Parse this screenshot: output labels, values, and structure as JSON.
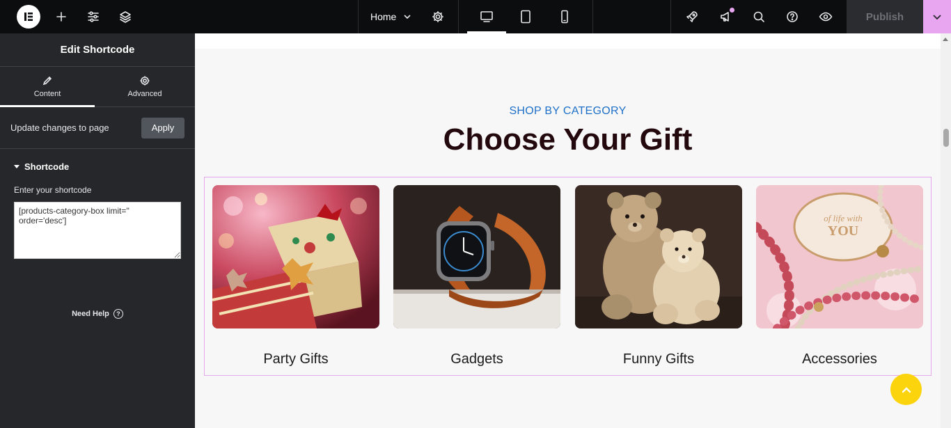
{
  "topbar": {
    "home_label": "Home",
    "publish_label": "Publish"
  },
  "panel": {
    "title": "Edit Shortcode",
    "tabs": [
      {
        "label": "Content",
        "icon": "pencil-icon",
        "active": true
      },
      {
        "label": "Advanced",
        "icon": "gear-icon",
        "active": false
      }
    ],
    "update_text": "Update changes to page",
    "apply_label": "Apply",
    "section_title": "Shortcode",
    "field_label": "Enter your shortcode",
    "shortcode_value": "[products-category-box limit=''\norder='desc']",
    "need_help": "Need Help"
  },
  "page": {
    "kicker": "SHOP BY CATEGORY",
    "heading": "Choose Your Gift",
    "categories": [
      {
        "label": "Party Gifts",
        "image": "wrapped-gifts-photo"
      },
      {
        "label": "Gadgets",
        "image": "smartwatch-photo"
      },
      {
        "label": "Funny Gifts",
        "image": "teddy-bears-photo"
      },
      {
        "label": "Accessories",
        "image": "pearl-jewelry-photo"
      }
    ]
  },
  "colors": {
    "topbar_bg": "#0c0d0e",
    "sidebar_bg": "#26272b",
    "accent_pink": "#e8a6f0",
    "kicker_blue": "#1e70c9",
    "heading_dark": "#23080d",
    "scroll_top_yellow": "#fbd40d"
  }
}
